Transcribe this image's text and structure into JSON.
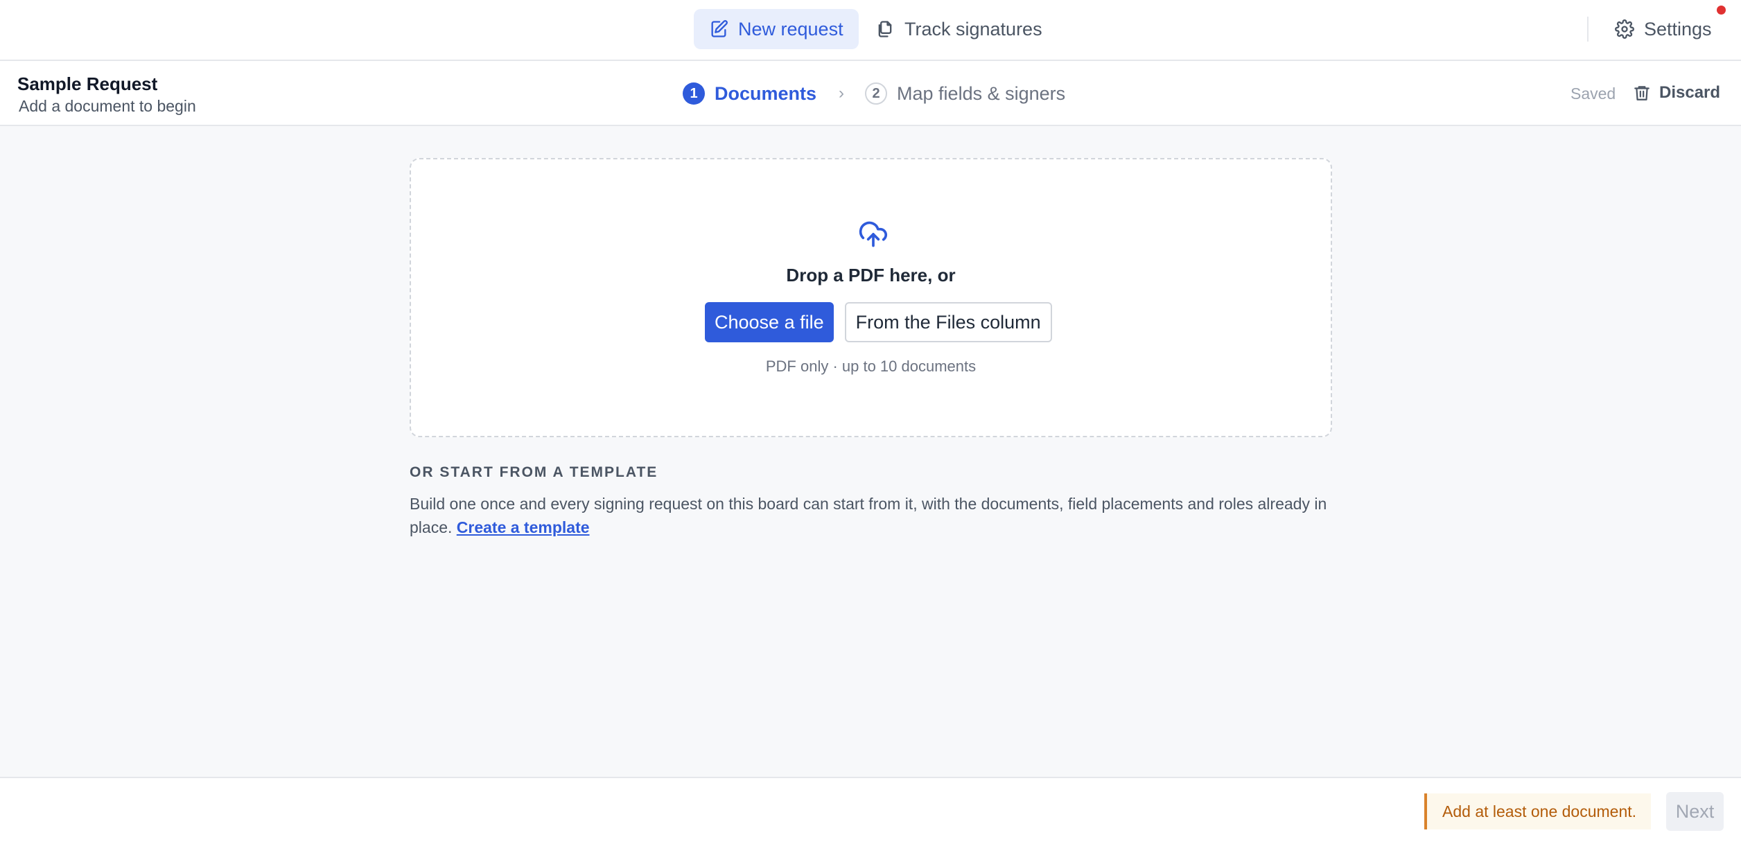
{
  "topnav": {
    "tabs": [
      {
        "label": "New request",
        "icon": "edit-document-icon",
        "active": true
      },
      {
        "label": "Track signatures",
        "icon": "copy-documents-icon",
        "active": false
      }
    ],
    "settings_label": "Settings",
    "accent_color": "#2f5bdb",
    "notification_color": "#e03131"
  },
  "request": {
    "title": "Sample Request",
    "subtitle": "Add a document to begin"
  },
  "steps": [
    {
      "number": "1",
      "label": "Documents",
      "active": true
    },
    {
      "number": "2",
      "label": "Map fields & signers",
      "active": false
    }
  ],
  "status": {
    "saved_label": "Saved",
    "discard_label": "Discard"
  },
  "dropzone": {
    "icon": "cloud-upload-icon",
    "title": "Drop a PDF here, or",
    "choose_file_label": "Choose a file",
    "files_column_label": "From the Files column",
    "hint": "PDF only · up to 10 documents"
  },
  "template": {
    "heading": "OR START FROM A TEMPLATE",
    "body": "Build one once and every signing request on this board can start from it, with the documents, field placements and roles already in place.",
    "link_label": "Create a template"
  },
  "footer": {
    "warning": "Add at least one document.",
    "next_label": "Next",
    "warning_color": "#d9822b"
  }
}
